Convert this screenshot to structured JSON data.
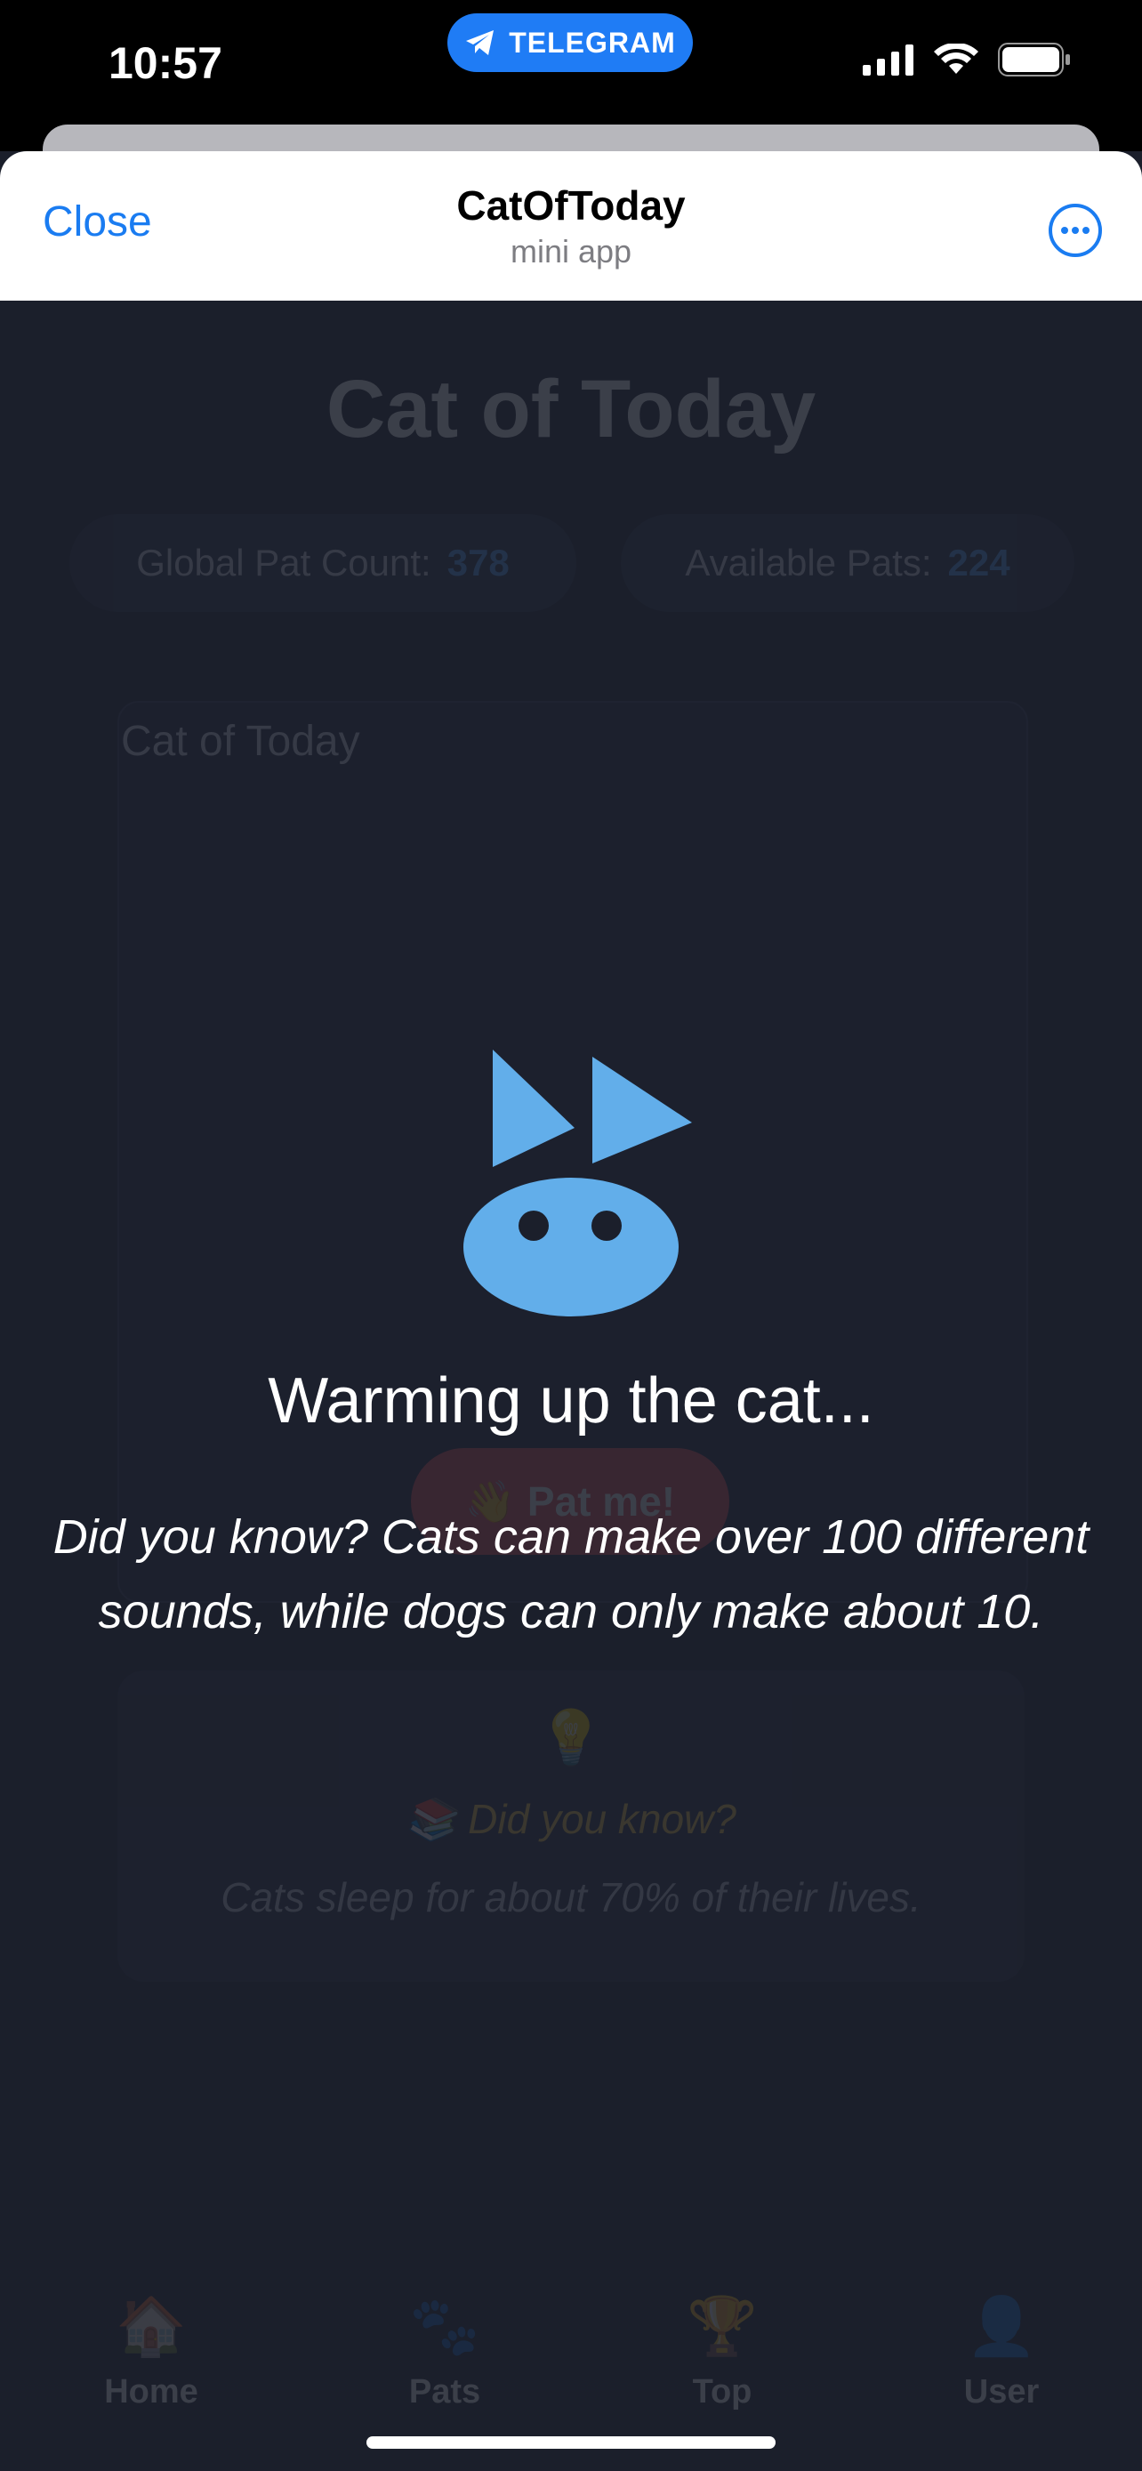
{
  "status_bar": {
    "time": "10:57",
    "pill_label": "TELEGRAM",
    "icons": [
      "signal-icon",
      "wifi-icon",
      "battery-icon"
    ]
  },
  "header": {
    "close_label": "Close",
    "title": "CatOfToday",
    "subtitle": "mini app",
    "more_icon": "more-icon"
  },
  "background_page": {
    "title": "Cat of Today",
    "stats": [
      {
        "label": "Global Pat Count:",
        "value": "378"
      },
      {
        "label": "Available Pats:",
        "value": "224"
      }
    ],
    "card_label": "Cat of Today",
    "pat_button": "👋 Pat me!",
    "fact_icon": "💡",
    "fact_title": "📚 Did you know?",
    "fact_text": "Cats sleep for about 70% of their lives.",
    "tabs": [
      {
        "icon": "🏠",
        "label": "Home"
      },
      {
        "icon": "🐾",
        "label": "Pats"
      },
      {
        "icon": "🏆",
        "label": "Top"
      },
      {
        "icon": "👤",
        "label": "User"
      }
    ]
  },
  "overlay": {
    "heading": "Warming up the cat...",
    "fact": "Did you know? Cats can make over 100 different sounds, while dogs can only make about 10."
  },
  "colors": {
    "accent": "#1a7cf1",
    "background": "#1b1f2b",
    "logo": "#62aeea"
  }
}
